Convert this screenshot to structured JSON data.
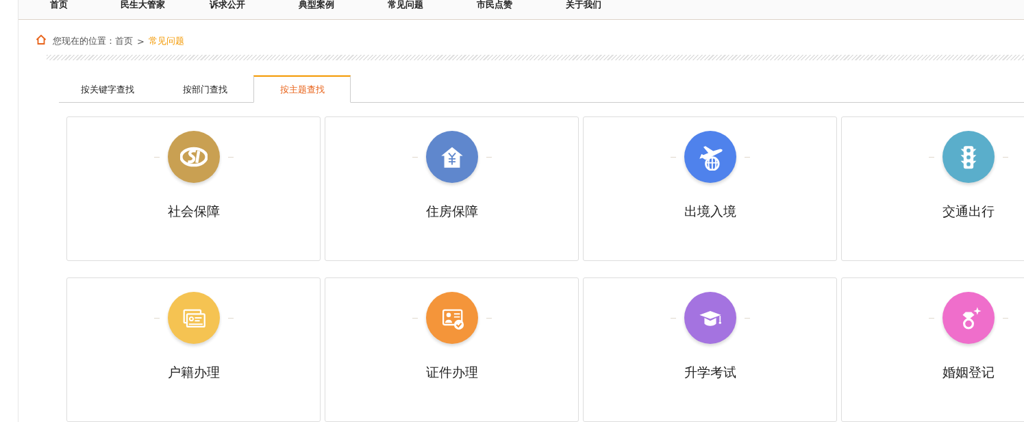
{
  "nav": {
    "items": [
      "首页",
      "民生大管家",
      "诉求公开",
      "典型案例",
      "常见问题",
      "市民点赞",
      "关于我们"
    ]
  },
  "breadcrumb": {
    "label": "您现在的位置：",
    "items": [
      {
        "text": "首页",
        "selected": false
      },
      {
        "text": "常见问题",
        "selected": true
      }
    ],
    "separator": ">"
  },
  "tabs": [
    {
      "label": "按关键字查找",
      "selected": false
    },
    {
      "label": "按部门查找",
      "selected": false
    },
    {
      "label": "按主题查找",
      "selected": true
    }
  ],
  "topics": [
    {
      "title": "社会保障",
      "kind": "si",
      "color": "#c9a052"
    },
    {
      "title": "住房保障",
      "kind": "house",
      "color": "#5f87cd"
    },
    {
      "title": "出境入境",
      "kind": "plane",
      "color": "#4f82ec"
    },
    {
      "title": "交通出行",
      "kind": "traffic",
      "color": "#5aaecb"
    },
    {
      "title": "户籍办理",
      "kind": "cards",
      "color": "#f5c352"
    },
    {
      "title": "证件办理",
      "kind": "idcard",
      "color": "#f4953a"
    },
    {
      "title": "升学考试",
      "kind": "cap",
      "color": "#a473e0"
    },
    {
      "title": "婚姻登记",
      "kind": "ring",
      "color": "#ef6ecb"
    }
  ]
}
